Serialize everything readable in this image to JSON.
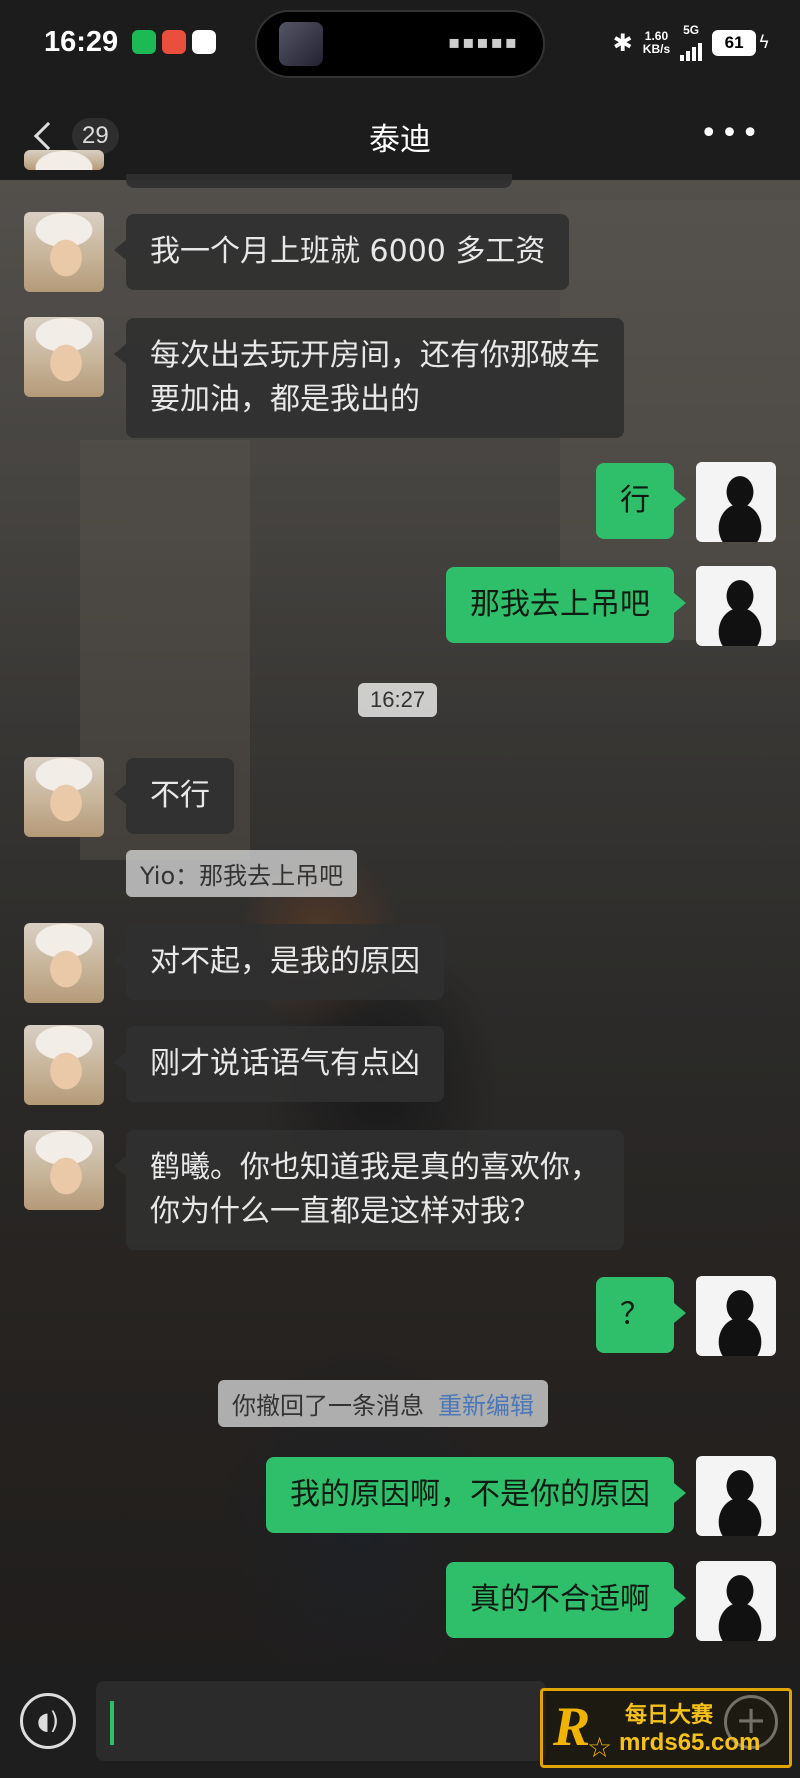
{
  "status_bar": {
    "time": "16:29",
    "net_speed": "1.60",
    "net_unit": "KB/s",
    "network_type": "5G",
    "battery": "61"
  },
  "nav": {
    "unread_count": "29",
    "title": "泰迪"
  },
  "messages": [
    {
      "side": "in",
      "text": "我一个月上班就 6000 多工资"
    },
    {
      "side": "in",
      "text": "每次出去玩开房间，还有你那破车\n要加油，都是我出的"
    },
    {
      "side": "out",
      "text": "行"
    },
    {
      "side": "out",
      "text": "那我去上吊吧"
    },
    {
      "side": "in",
      "text": "不行"
    },
    {
      "side": "in",
      "text": "对不起，是我的原因"
    },
    {
      "side": "in",
      "text": "刚才说话语气有点凶"
    },
    {
      "side": "in",
      "text": "鹤曦。你也知道我是真的喜欢你，\n你为什么一直都是这样对我？"
    },
    {
      "side": "out",
      "text": "？"
    },
    {
      "side": "out",
      "text": "我的原因啊，不是你的原因"
    },
    {
      "side": "out",
      "text": "真的不合适啊"
    }
  ],
  "timestamp": "16:27",
  "quote_reply": "Yio：那我去上吊吧",
  "system_notice": {
    "text": "你撤回了一条消息",
    "action": "重新编辑"
  },
  "input_bar": {
    "value": ""
  },
  "watermark": {
    "logo": "R",
    "title": "每日大赛",
    "url": "mrds65.com"
  },
  "colors": {
    "outgoing_bubble": "#2fbf6a",
    "incoming_bubble": "#303030",
    "bar_background": "#1c1c1c"
  }
}
